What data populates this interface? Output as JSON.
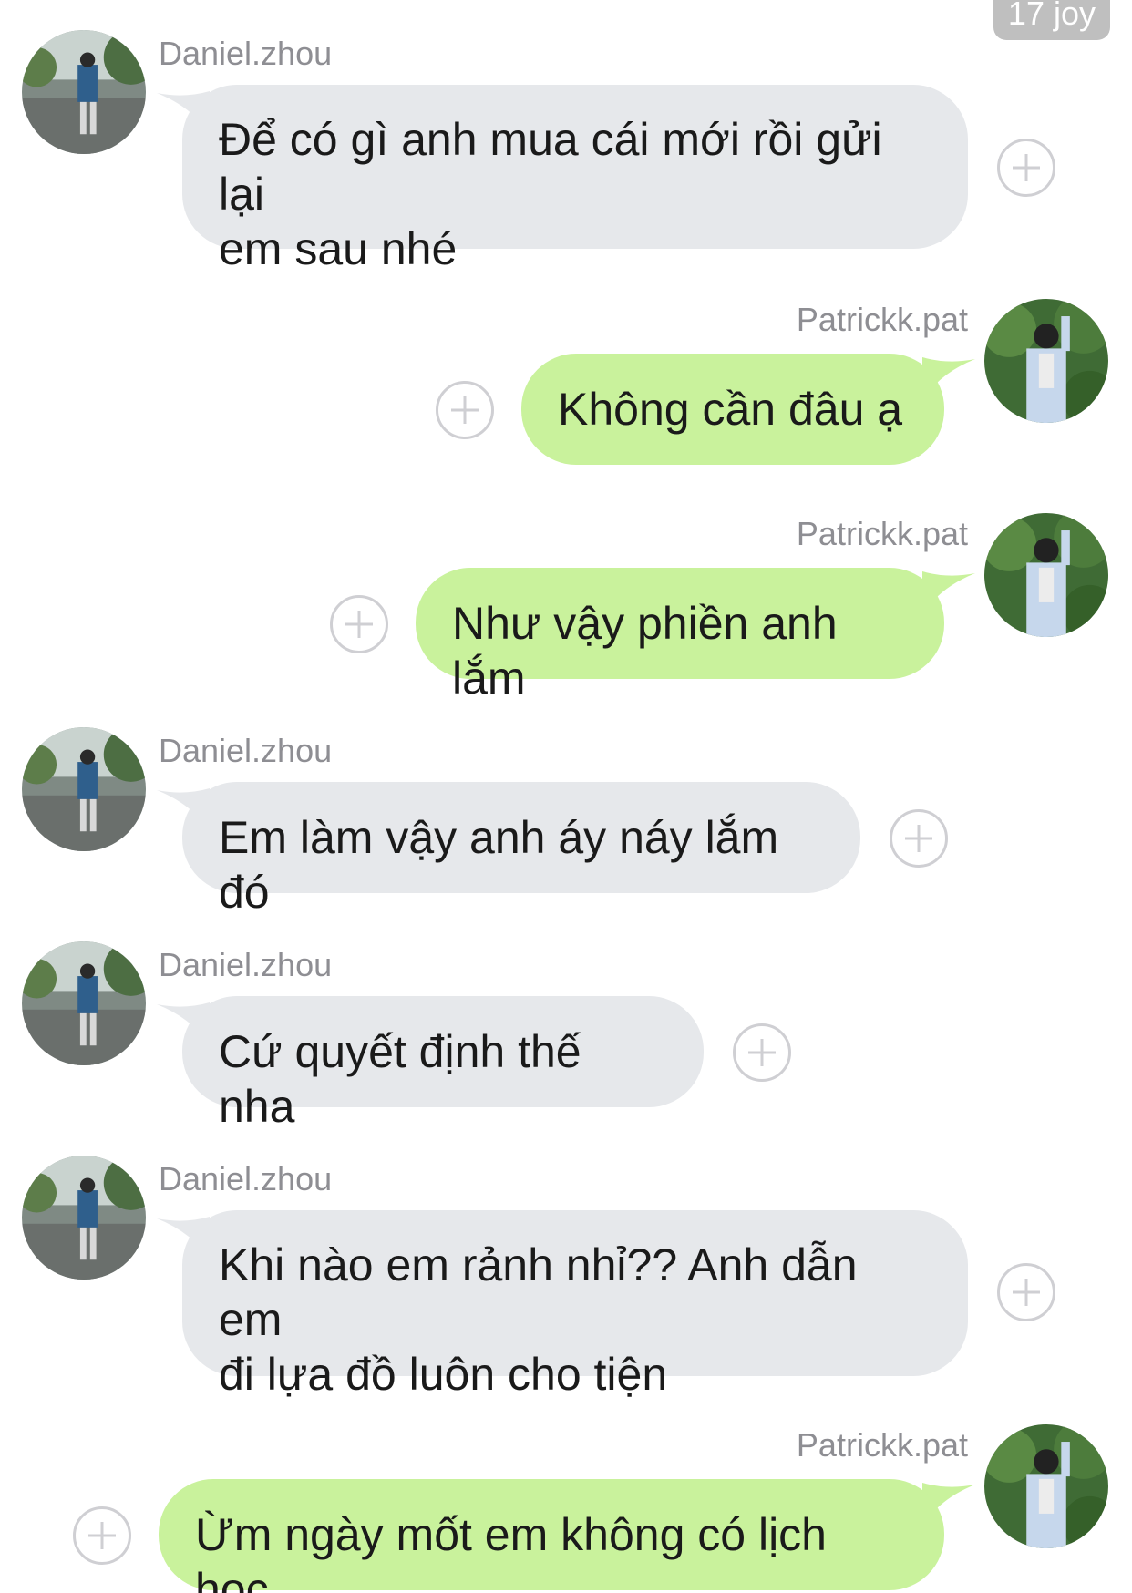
{
  "watermark": "17 joy",
  "messages": [
    {
      "sender": "Daniel.zhou",
      "text_lines": [
        "Để có gì anh mua cái mới rồi gửi lại",
        "em sau nhé"
      ],
      "direction": "incoming"
    },
    {
      "sender": "Patrickk.pat",
      "text_lines": [
        "Không cần đâu  ạ"
      ],
      "direction": "outgoing"
    },
    {
      "sender": "Patrickk.pat",
      "text_lines": [
        "Như vậy phiền anh lắm"
      ],
      "direction": "outgoing"
    },
    {
      "sender": "Daniel.zhou",
      "text_lines": [
        "Em làm vậy anh áy náy lắm đó"
      ],
      "direction": "incoming"
    },
    {
      "sender": "Daniel.zhou",
      "text_lines": [
        "Cứ quyết định thế nha"
      ],
      "direction": "incoming"
    },
    {
      "sender": "Daniel.zhou",
      "text_lines": [
        "Khi nào em rảnh nhỉ?? Anh dẫn em",
        "đi lựa đồ luôn cho tiện"
      ],
      "direction": "incoming"
    },
    {
      "sender": "Patrickk.pat",
      "text_lines": [
        "Ừm ngày mốt em không có lịch học"
      ],
      "direction": "outgoing"
    }
  ],
  "colors": {
    "incoming_bubble": "#e6e8eb",
    "outgoing_bubble": "#c9f29c",
    "sender_text": "#8e8e93",
    "plus_icon": "#cfcfd3"
  }
}
